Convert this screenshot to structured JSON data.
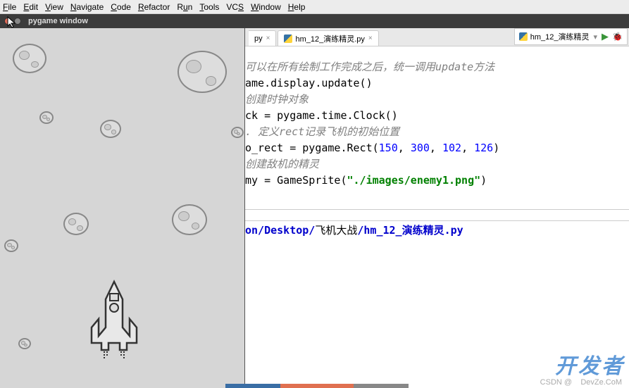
{
  "menubar": {
    "items": [
      "File",
      "Edit",
      "View",
      "Navigate",
      "Code",
      "Refactor",
      "Run",
      "Tools",
      "VCS",
      "Window",
      "Help"
    ]
  },
  "window": {
    "title": "pygame window"
  },
  "tabs": {
    "left_partial": "py",
    "active": "hm_12_演练精灵.py"
  },
  "run_config": {
    "name": "hm_12_演练精灵"
  },
  "code": {
    "l1": {
      "text": "可以在所有绘制工作完成之后，统一调用update方法"
    },
    "l2": "ame.display.update()",
    "l3": "",
    "l4": {
      "text": "创建时钟对象"
    },
    "l5": "ck = pygame.time.Clock()",
    "l6": "",
    "l7": {
      "text": ". 定义rect记录飞机的初始位置"
    },
    "l8a": "o_rect = pygame.Rect(",
    "l8_n1": "150",
    "l8_c1": ", ",
    "l8_n2": "300",
    "l8_c2": ", ",
    "l8_n3": "102",
    "l8_c3": ", ",
    "l8_n4": "126",
    "l8_end": ")",
    "l9": "",
    "l10": {
      "text": "创建敌机的精灵"
    },
    "l11a": "my = GameSprite(",
    "l11_str": "\"./images/enemy1.png\"",
    "l11_end": ")",
    "path_a": "on/Desktop/",
    "path_b": "飞机大战",
    "path_c": "/hm_12_演练精灵.py"
  },
  "watermarks": {
    "logo": "开发者",
    "sub": "DevZe.CoM",
    "csdn": "CSDN @"
  }
}
